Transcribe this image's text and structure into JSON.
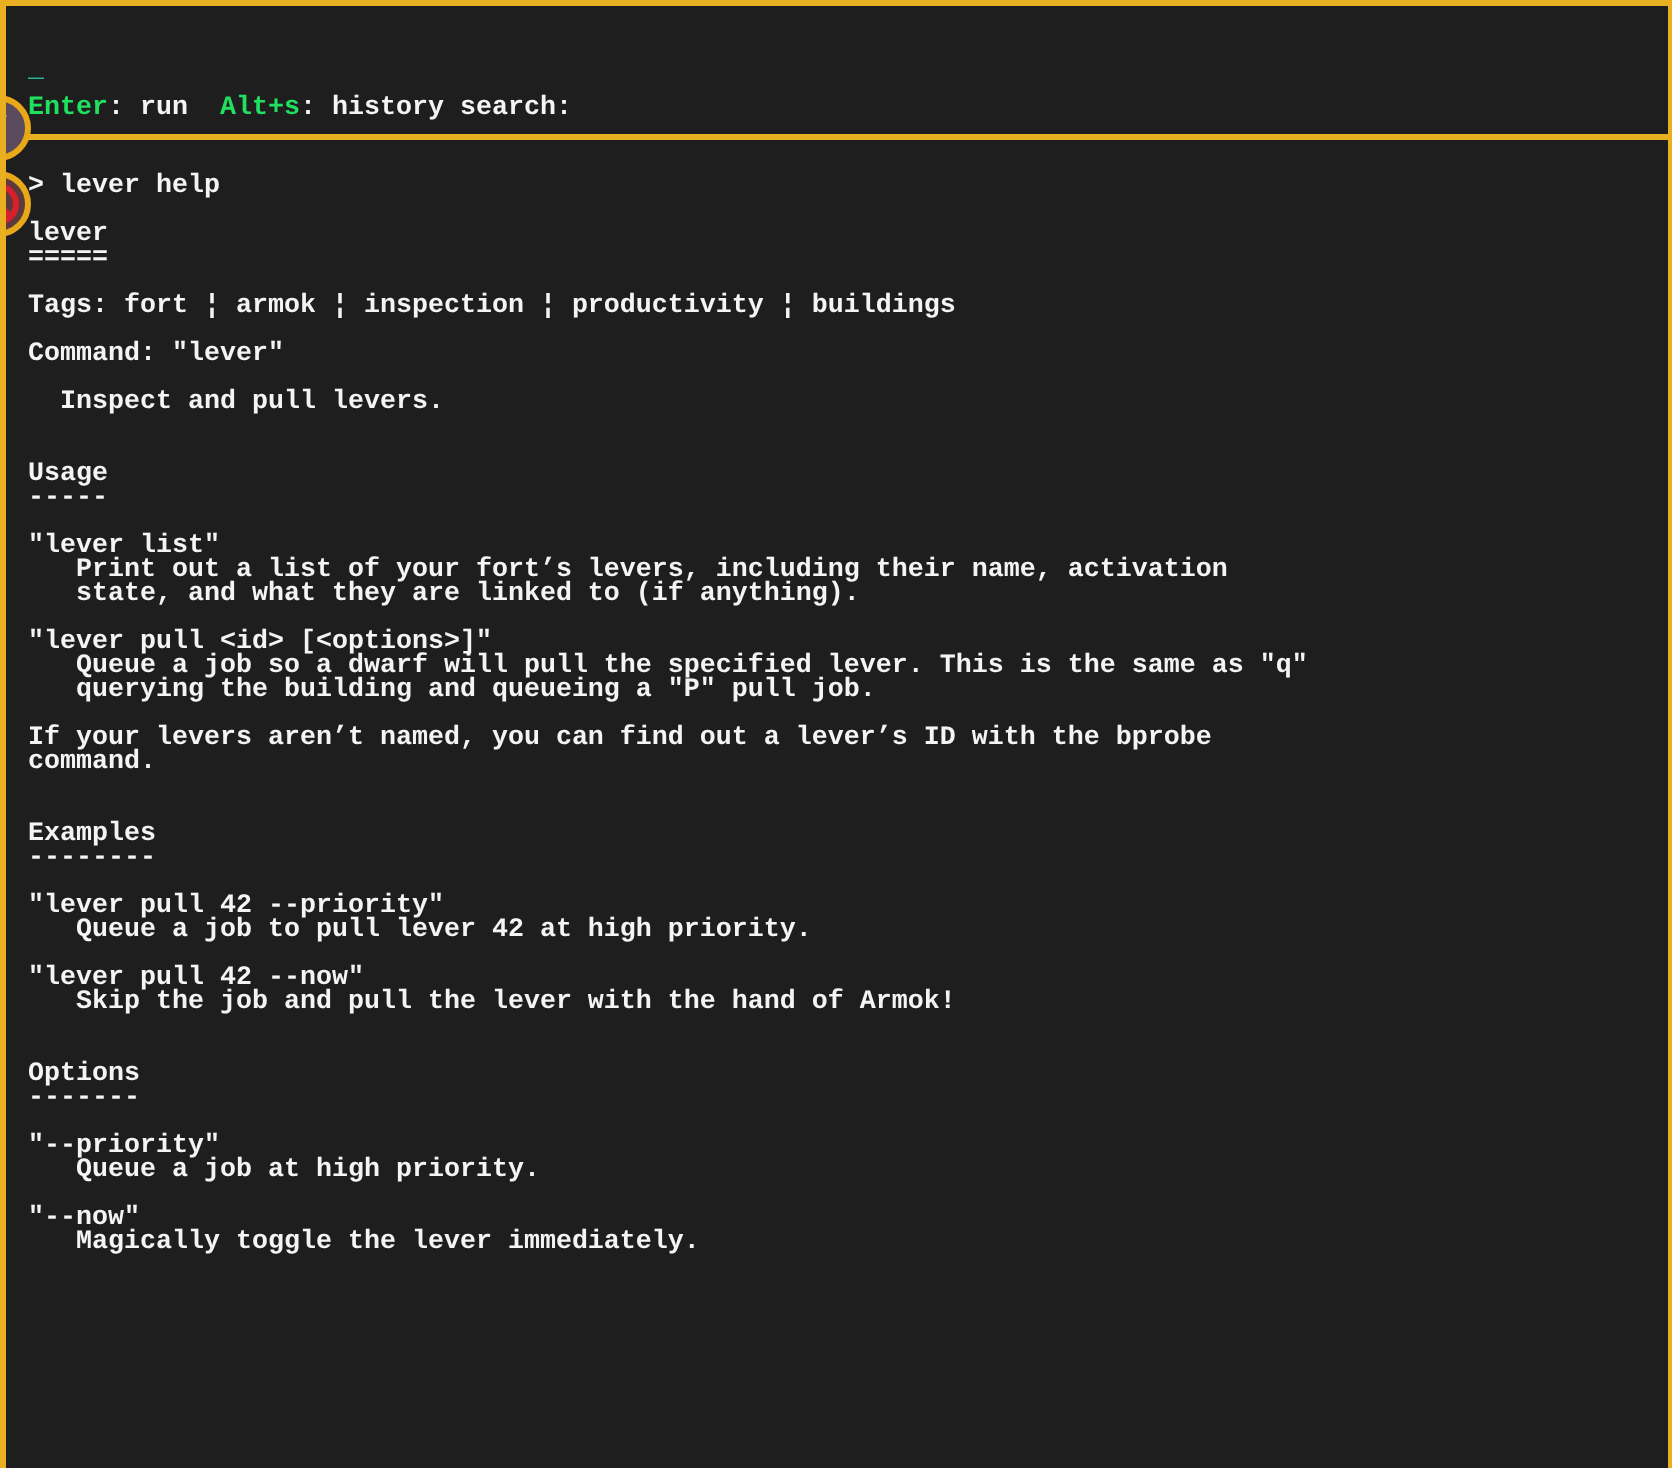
{
  "console": {
    "cursor": "_",
    "hints": [
      {
        "key": "Enter",
        "action": ": run"
      },
      {
        "key": "Alt+s",
        "action": ": history search:"
      }
    ]
  },
  "output": [
    {
      "kind": "prompt",
      "lines": [
        "> lever help"
      ]
    },
    {
      "kind": "title",
      "lines": [
        "lever",
        "====="
      ]
    },
    {
      "kind": "para",
      "lines": [
        "Tags: fort ¦ armok ¦ inspection ¦ productivity ¦ buildings"
      ]
    },
    {
      "kind": "para",
      "lines": [
        "Command: \"lever\""
      ]
    },
    {
      "kind": "para",
      "lines": [
        "  Inspect and pull levers."
      ]
    },
    {
      "kind": "section",
      "lines": [
        "Usage",
        "-----"
      ]
    },
    {
      "kind": "para",
      "lines": [
        "\"lever list\"",
        "   Print out a list of your fort’s levers, including their name, activation",
        "   state, and what they are linked to (if anything)."
      ]
    },
    {
      "kind": "para",
      "lines": [
        "\"lever pull <id> [<options>]\"",
        "   Queue a job so a dwarf will pull the specified lever. This is the same as \"q\"",
        "   querying the building and queueing a \"P\" pull job."
      ]
    },
    {
      "kind": "para",
      "lines": [
        "If your levers aren’t named, you can find out a lever’s ID with the bprobe",
        "command."
      ]
    },
    {
      "kind": "section",
      "lines": [
        "Examples",
        "--------"
      ]
    },
    {
      "kind": "para",
      "lines": [
        "\"lever pull 42 --priority\"",
        "   Queue a job to pull lever 42 at high priority."
      ]
    },
    {
      "kind": "para",
      "lines": [
        "\"lever pull 42 --now\"",
        "   Skip the job and pull the lever with the hand of Armok!"
      ]
    },
    {
      "kind": "section",
      "lines": [
        "Options",
        "-------"
      ]
    },
    {
      "kind": "para",
      "lines": [
        "\"--priority\"",
        "   Queue a job at high priority."
      ]
    },
    {
      "kind": "para",
      "lines": [
        "\"--now\"",
        "   Magically toggle the lever immediately."
      ]
    }
  ]
}
